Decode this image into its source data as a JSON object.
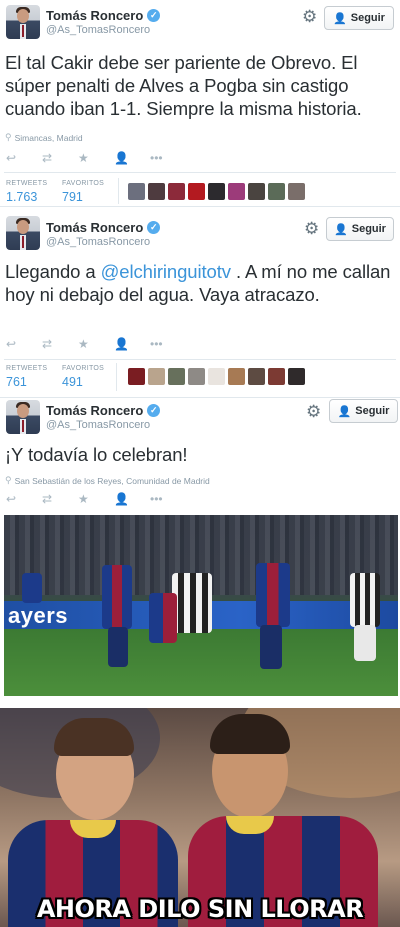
{
  "tweets": [
    {
      "name": "Tomás Roncero",
      "handle": "@As_TomasRoncero",
      "follow_label": "Seguir",
      "text": "El tal Cakir debe ser pariente de Obrevo. El súper penalti de Alves a Pogba sin castigo cuando iban 1-1. Siempre la misma historia.",
      "location": "Simancas, Madrid",
      "retweets_label": "RETWEETS",
      "retweets": "1.763",
      "favorites_label": "FAVORITOS",
      "favorites": "791"
    },
    {
      "name": "Tomás Roncero",
      "handle": "@As_TomasRoncero",
      "follow_label": "Seguir",
      "text_before": "Llegando a ",
      "mention": "@elchiringuitotv",
      "text_after": " . A mí no me callan hoy ni debajo del agua. Vaya atracazo.",
      "retweets_label": "RETWEETS",
      "retweets": "761",
      "favorites_label": "FAVORITOS",
      "favorites": "491"
    },
    {
      "name": "Tomás Roncero",
      "handle": "@As_TomasRoncero",
      "follow_label": "Seguir",
      "text": "¡Y todavía lo celebran!",
      "location": "San Sebastián de los Reyes, Comunidad de Madrid"
    }
  ],
  "icons": {
    "verified": "verified-badge-icon",
    "gear": "gear-icon",
    "follow": "add-user-icon",
    "location": "location-pin-icon",
    "reply": "reply-icon",
    "retweet": "retweet-icon",
    "favorite": "star-icon",
    "follow_action": "follow-icon",
    "more": "more-icon"
  },
  "photo1": {
    "board_text": "ayers"
  },
  "photo2": {
    "caption": "AHORA DILO SIN LLORAR"
  },
  "colors": {
    "link": "#3b94d9",
    "verified": "#55acee",
    "muted": "#8899a6"
  }
}
